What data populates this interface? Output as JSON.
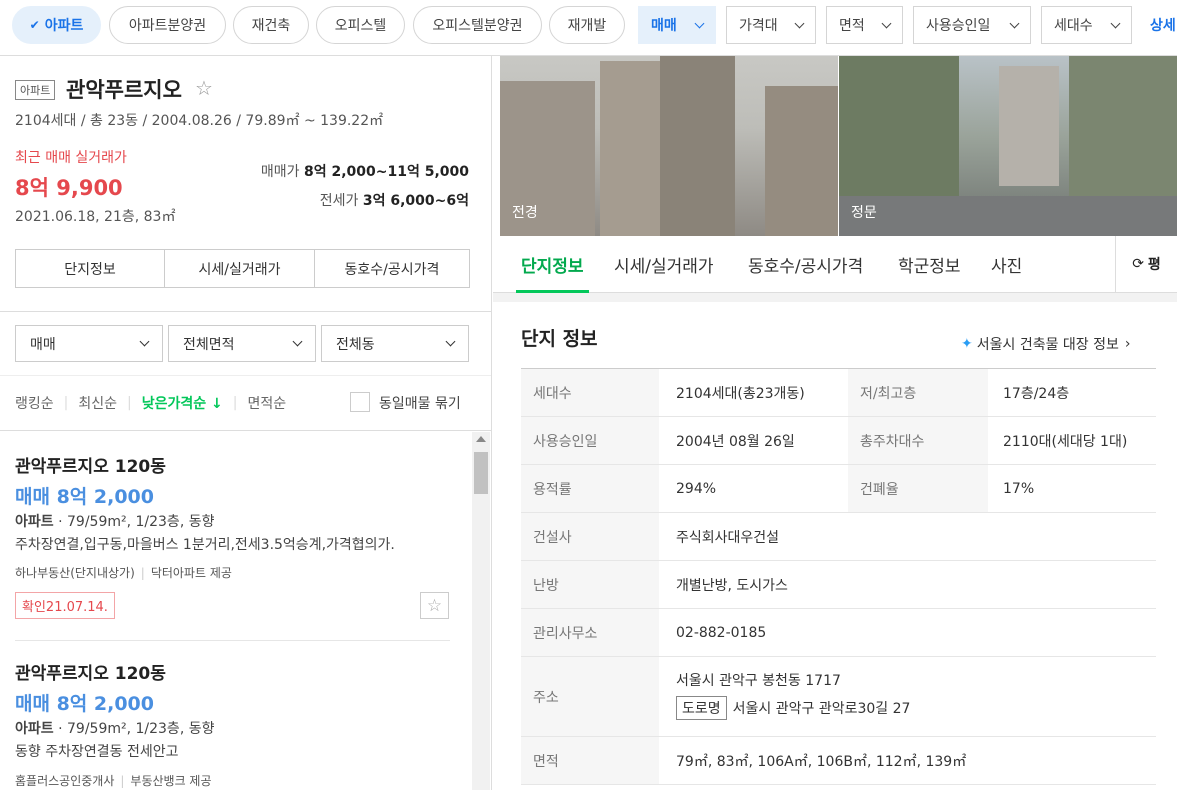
{
  "filters": {
    "apt_chip": "아파트",
    "chips": [
      "아파트분양권",
      "재건축",
      "오피스텔",
      "오피스텔분양권",
      "재개발"
    ],
    "trade_type": "매매",
    "dropdowns": [
      "가격대",
      "면적",
      "사용승인일",
      "세대수"
    ],
    "detail": "상세"
  },
  "complex": {
    "tag": "아파트",
    "name": "관악푸르지오",
    "summary": "2104세대 / 총 23동 / 2004.08.26 / 79.89㎡ ~ 139.22㎡",
    "recent_label": "최근 매매 실거래가",
    "recent_price": "8억 9,900",
    "recent_detail": "2021.06.18, 21층, 83㎡",
    "sale_label": "매매가",
    "sale_range": "8억 2,000~11억 5,000",
    "jeonse_label": "전세가",
    "jeonse_range": "3억 6,000~6억",
    "buttons": [
      "단지정보",
      "시세/실거래가",
      "동호수/공시가격"
    ]
  },
  "list_filters": {
    "type": "매매",
    "area": "전체면적",
    "dong": "전체동"
  },
  "sort": {
    "items": [
      "랭킹순",
      "최신순",
      "낮은가격순",
      "면적순"
    ],
    "active": "낮은가격순",
    "arrow": "↓",
    "group_label": "동일매물 묶기"
  },
  "listings": [
    {
      "title": "관악푸르지오 120동",
      "price": "매매 8억 2,000",
      "type": "아파트",
      "spec": "79/59m², 1/23층, 동향",
      "desc": "주차장연결,입구동,마을버스 1분거리,전세3.5억승계,가격협의가.",
      "agent": "하나부동산(단지내상가)",
      "provider": "닥터아파트 제공",
      "confirm": "확인21.07.14."
    },
    {
      "title": "관악푸르지오 120동",
      "price": "매매 8억 2,000",
      "type": "아파트",
      "spec": "79/59m², 1/23층, 동향",
      "desc": "동향 주차장연결동 전세안고",
      "agent": "홈플러스공인중개사",
      "provider": "부동산뱅크 제공"
    }
  ],
  "photos": [
    {
      "label": "전경"
    },
    {
      "label": "정문"
    }
  ],
  "tabs": [
    "단지정보",
    "시세/실거래가",
    "동호수/공시가격",
    "학군정보",
    "사진"
  ],
  "active_tab": "단지정보",
  "unit_toggle": "평",
  "info": {
    "title": "단지 정보",
    "link": "서울시 건축물 대장 정보",
    "rows": [
      {
        "l1": "세대수",
        "v1": "2104세대(총23개동)",
        "l2": "저/최고층",
        "v2": "17층/24층"
      },
      {
        "l1": "사용승인일",
        "v1": "2004년 08월 26일",
        "l2": "총주차대수",
        "v2": "2110대(세대당 1대)"
      },
      {
        "l1": "용적률",
        "v1": "294%",
        "l2": "건폐율",
        "v2": "17%"
      },
      {
        "l1": "건설사",
        "v1": "주식회사대우건설"
      },
      {
        "l1": "난방",
        "v1": "개별난방, 도시가스"
      },
      {
        "l1": "관리사무소",
        "v1": "02-882-0185"
      }
    ],
    "address_label": "주소",
    "address_lot": "서울시 관악구 봉천동 1717",
    "road_tag": "도로명",
    "address_road": "서울시 관악구 관악로30길 27",
    "area_label": "면적",
    "area_value": "79㎡, 83㎡, 106A㎡, 106B㎡, 112㎡, 139㎡"
  },
  "colors": {
    "accent": "#1a73e8",
    "price_red": "#e5484d",
    "sort_green": "#03c75a",
    "listing_blue": "#4a8fe0"
  }
}
